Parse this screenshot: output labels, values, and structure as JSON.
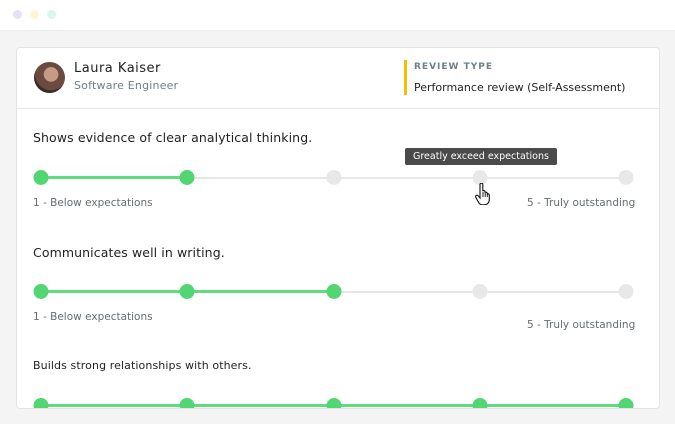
{
  "window": {
    "dots": [
      "#e7defa",
      "#fff5d6",
      "#d8f7ec"
    ]
  },
  "employee": {
    "name": "Laura Kaiser",
    "role": "Software Engineer"
  },
  "review": {
    "label": "REVIEW TYPE",
    "value": "Performance review (Self-Assessment)",
    "accent": "#f5c000"
  },
  "questions": [
    {
      "text": "Shows evidence of clear analytical thinking.",
      "selected_level": 2,
      "levels": 5,
      "min_label": "1 - Below expectations",
      "max_label": "5 - Truly outstanding"
    },
    {
      "text": "Communicates well in writing.",
      "selected_level": 3,
      "levels": 5,
      "min_label": "1 - Below expectations",
      "max_label": "5 - Truly outstanding"
    },
    {
      "text": "Builds strong relationships with others.",
      "selected_level": 5,
      "levels": 5
    }
  ],
  "tooltip": {
    "text": "Greatly exceed expectations"
  },
  "colors": {
    "active": "#52d671",
    "inactive": "#e8e8e8"
  }
}
